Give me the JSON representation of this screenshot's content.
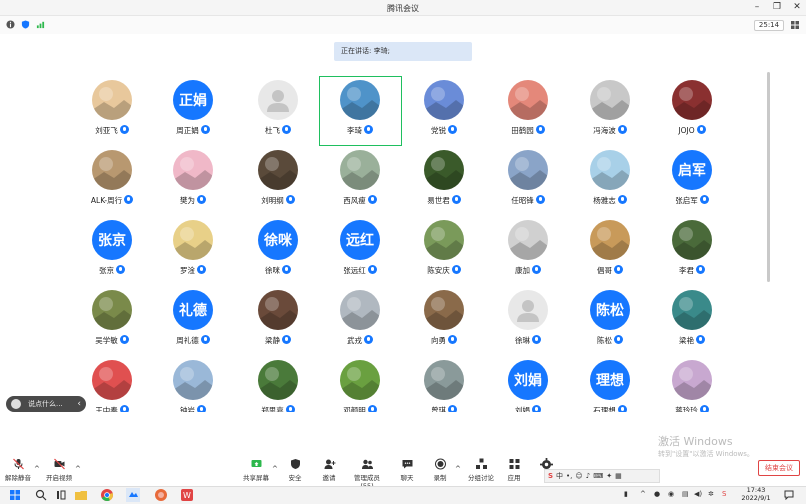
{
  "window": {
    "title": "腾讯会议",
    "timer": "25:14"
  },
  "speaking_label": "正在讲话: 李琦;",
  "participants": [
    {
      "name": "刘亚飞",
      "avatar": "photo",
      "color": "#e8c89c"
    },
    {
      "name": "周正娟",
      "avatar": "text",
      "text": "正娟"
    },
    {
      "name": "杜飞",
      "avatar": "default"
    },
    {
      "name": "李琦",
      "avatar": "photo",
      "color": "#4f93c9"
    },
    {
      "name": "党锐",
      "avatar": "photo",
      "color": "#6a8cd8"
    },
    {
      "name": "田鹤园",
      "avatar": "photo",
      "color": "#e4887a"
    },
    {
      "name": "冯海波",
      "avatar": "photo",
      "color": "#c8c8c8"
    },
    {
      "name": "JOJO",
      "avatar": "photo",
      "color": "#8a3030"
    },
    {
      "name": "ALK-周行",
      "avatar": "photo",
      "color": "#b89870"
    },
    {
      "name": "樊为",
      "avatar": "photo",
      "color": "#f0b8c8"
    },
    {
      "name": "刘明纲",
      "avatar": "photo",
      "color": "#5a4a3a"
    },
    {
      "name": "西风瘦",
      "avatar": "photo",
      "color": "#9ab09a"
    },
    {
      "name": "易世君",
      "avatar": "photo",
      "color": "#3a5a2a"
    },
    {
      "name": "任昭锋",
      "avatar": "photo",
      "color": "#8aa4c8"
    },
    {
      "name": "杨雅志",
      "avatar": "photo",
      "color": "#a8d0e8"
    },
    {
      "name": "张启军",
      "avatar": "text",
      "text": "启军"
    },
    {
      "name": "张京",
      "avatar": "text",
      "text": "张京"
    },
    {
      "name": "罗淦",
      "avatar": "photo",
      "color": "#e8d088"
    },
    {
      "name": "徐咪",
      "avatar": "text",
      "text": "徐咪"
    },
    {
      "name": "张远红",
      "avatar": "text",
      "text": "远红"
    },
    {
      "name": "陈安庆",
      "avatar": "photo",
      "color": "#7a9a5a"
    },
    {
      "name": "康加",
      "avatar": "photo",
      "color": "#d0d0d0"
    },
    {
      "name": "倡哥",
      "avatar": "photo",
      "color": "#c89a5a"
    },
    {
      "name": "李君",
      "avatar": "photo",
      "color": "#4a6a3a"
    },
    {
      "name": "吴学敏",
      "avatar": "photo",
      "color": "#7a8a4a"
    },
    {
      "name": "周礼德",
      "avatar": "text",
      "text": "礼德"
    },
    {
      "name": "梁静",
      "avatar": "photo",
      "color": "#6a4a3a"
    },
    {
      "name": "武戎",
      "avatar": "photo",
      "color": "#b0b8c0"
    },
    {
      "name": "向勇",
      "avatar": "photo",
      "color": "#8a6a4a"
    },
    {
      "name": "徐琳",
      "avatar": "default"
    },
    {
      "name": "陈松",
      "avatar": "text",
      "text": "陈松"
    },
    {
      "name": "梁艳",
      "avatar": "photo",
      "color": "#3a8a8a"
    },
    {
      "name": "王中秦",
      "avatar": "photo",
      "color": "#e05050"
    },
    {
      "name": "钟岩",
      "avatar": "photo",
      "color": "#9ab8d8"
    },
    {
      "name": "郑思嘉",
      "avatar": "photo",
      "color": "#4a7a3a"
    },
    {
      "name": "邓颜明",
      "avatar": "photo",
      "color": "#6aa040"
    },
    {
      "name": "曾琪",
      "avatar": "photo",
      "color": "#8a9a9a"
    },
    {
      "name": "刘娟",
      "avatar": "text",
      "text": "刘娟"
    },
    {
      "name": "石理想",
      "avatar": "text",
      "text": "理想"
    },
    {
      "name": "蒋玲玲",
      "avatar": "photo",
      "color": "#c8a8d0"
    }
  ],
  "chat": {
    "placeholder": "说点什么..."
  },
  "toolbar": {
    "mute": "解除静音",
    "video": "开启视频",
    "share": "共享屏幕",
    "security": "安全",
    "invite": "邀请",
    "members": "管理成员(55)",
    "chat": "聊天",
    "record": "录制",
    "breakout": "分组讨论",
    "apps": "应用",
    "end": "结束会议"
  },
  "watermark": {
    "line1": "激活 Windows",
    "line2": "转到\"设置\"以激活 Windows。"
  },
  "ime": {
    "lang": "中"
  },
  "clock": {
    "time": "17:43",
    "date": "2022/9/1"
  },
  "colors": {
    "accent": "#1677ff",
    "active_border": "#1fbf5f",
    "danger": "#e04444"
  }
}
